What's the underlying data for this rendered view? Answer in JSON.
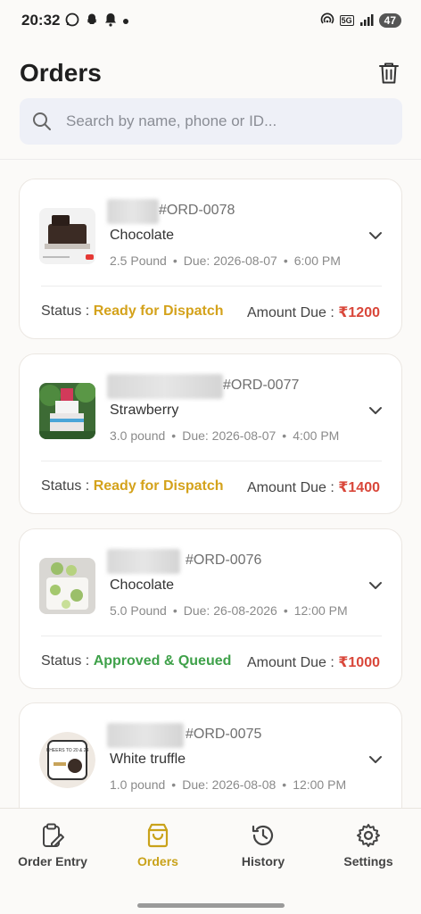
{
  "status_bar": {
    "time": "20:32",
    "network": "5G",
    "battery": "47"
  },
  "header": {
    "title": "Orders"
  },
  "search": {
    "placeholder": "Search by name, phone or ID..."
  },
  "colors": {
    "accent": "#c9a21a",
    "ready": "#d4a21b",
    "approved": "#3fa14a",
    "amount": "#d9473a"
  },
  "orders": [
    {
      "id": "#ORD-0078",
      "flavor": "Chocolate",
      "weight": "2.5 Pound",
      "due": "Due: 2026-08-07",
      "time": "6:00 PM",
      "status_label": "Status : ",
      "status": "Ready for Dispatch",
      "amount_label": "Amount Due : ",
      "amount": "₹1200"
    },
    {
      "id": "#ORD-0077",
      "flavor": "Strawberry",
      "weight": "3.0 pound",
      "due": "Due: 2026-08-07",
      "time": "4:00 PM",
      "status_label": "Status : ",
      "status": "Ready for Dispatch",
      "amount_label": "Amount Due : ",
      "amount": "₹1400"
    },
    {
      "id": "#ORD-0076",
      "flavor": "Chocolate",
      "weight": "5.0 Pound",
      "due": "Due: 26-08-2026",
      "time": "12:00 PM",
      "status_label": "Status : ",
      "status": "Approved & Queued",
      "amount_label": "Amount Due : ",
      "amount": "₹1000"
    },
    {
      "id": "#ORD-0075",
      "flavor": "White truffle",
      "weight": "1.0 pound",
      "due": "Due: 2026-08-08",
      "time": "12:00 PM"
    }
  ],
  "nav": [
    {
      "label": "Order Entry",
      "icon": "clipboard-edit-icon"
    },
    {
      "label": "Orders",
      "icon": "shopping-bag-icon"
    },
    {
      "label": "History",
      "icon": "history-icon"
    },
    {
      "label": "Settings",
      "icon": "gear-icon"
    }
  ],
  "thumb_cake_text": "CHEERS TO 20 & 24"
}
